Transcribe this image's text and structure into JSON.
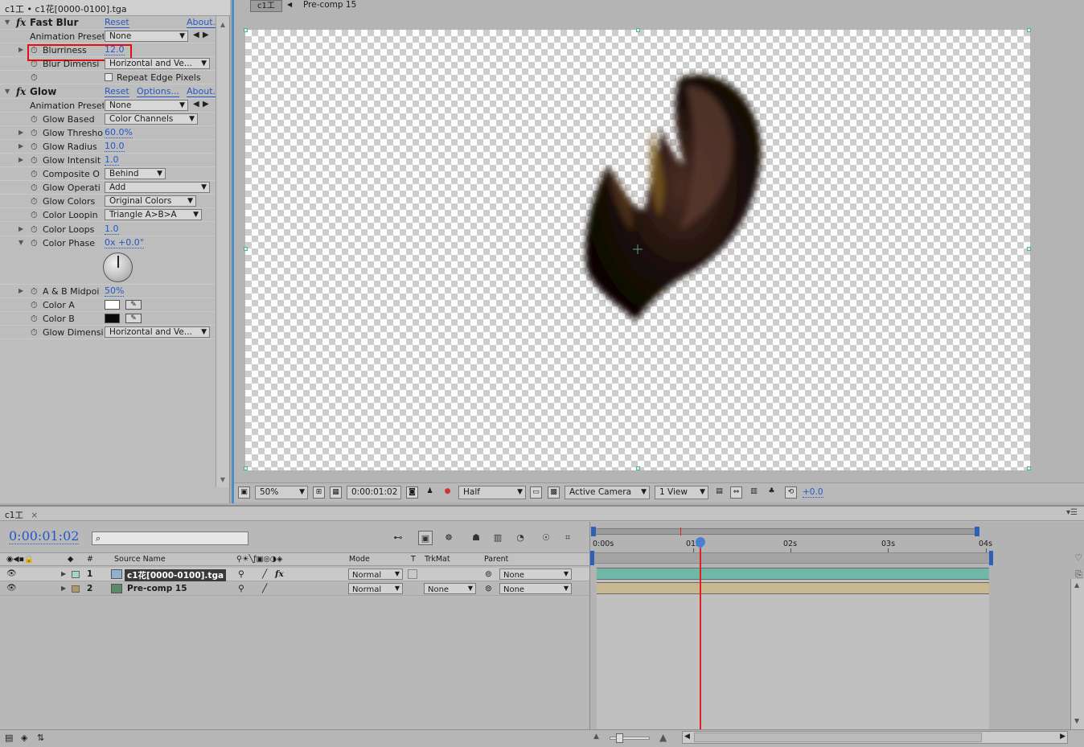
{
  "ec": {
    "header": "c1工 • c1花[0000-0100].tga",
    "fast_blur": {
      "name": "Fast Blur",
      "reset": "Reset",
      "about": "About...",
      "anim_label": "Animation Preset",
      "anim_value": "None",
      "blurriness_label": "Blurriness",
      "blurriness_value": "12.0",
      "blur_dim_label": "Blur Dimensi",
      "blur_dim_value": "Horizontal and Ve...",
      "repeat_edge": "Repeat Edge Pixels"
    },
    "glow": {
      "name": "Glow",
      "reset": "Reset",
      "options": "Options...",
      "about": "About...",
      "anim_label": "Animation Preset",
      "anim_value": "None",
      "based_label": "Glow Based",
      "based_value": "Color Channels",
      "thresh_label": "Glow Thresho",
      "thresh_value": "60.0%",
      "radius_label": "Glow Radius",
      "radius_value": "10.0",
      "intens_label": "Glow Intensit",
      "intens_value": "1.0",
      "composite_label": "Composite O",
      "composite_value": "Behind",
      "operation_label": "Glow Operati",
      "operation_value": "Add",
      "colors_label": "Glow Colors",
      "colors_value": "Original Colors",
      "looping_label": "Color Loopin",
      "looping_value": "Triangle A>B>A",
      "loops_label": "Color Loops",
      "loops_value": "1.0",
      "phase_label": "Color Phase",
      "phase_value": "0x +0.0°",
      "ab_label": "A & B Midpoi",
      "ab_value": "50%",
      "color_a_label": "Color A",
      "color_b_label": "Color B",
      "glow_dim_label": "Glow Dimensi",
      "glow_dim_value": "Horizontal and Ve..."
    }
  },
  "cv": {
    "tab1": "c1工",
    "tab2": "Pre-comp 15",
    "zoom": "50%",
    "time": "0:00:01:02",
    "resolution": "Half",
    "camera": "Active Camera",
    "views": "1 View",
    "exposure": "+0.0"
  },
  "tl": {
    "tab": "c1工",
    "timecode": "0:00:01:02",
    "cols": {
      "num": "#",
      "source": "Source Name",
      "mode": "Mode",
      "t": "T",
      "trkmat": "TrkMat",
      "parent": "Parent"
    },
    "layers": [
      {
        "num": "1",
        "name": "c1花[0000-0100].tga",
        "mode": "Normal",
        "trkmat": "",
        "parent": "None"
      },
      {
        "num": "2",
        "name": "Pre-comp 15",
        "mode": "Normal",
        "trkmat": "None",
        "parent": "None"
      }
    ],
    "ticks": [
      "0:00s",
      "01s",
      "02s",
      "03s",
      "04s"
    ]
  },
  "colors": {
    "accent": "#2458c8",
    "layer1_bar": "#6fb8a8",
    "layer2_bar": "#c9b993",
    "cti": "#e02020"
  }
}
